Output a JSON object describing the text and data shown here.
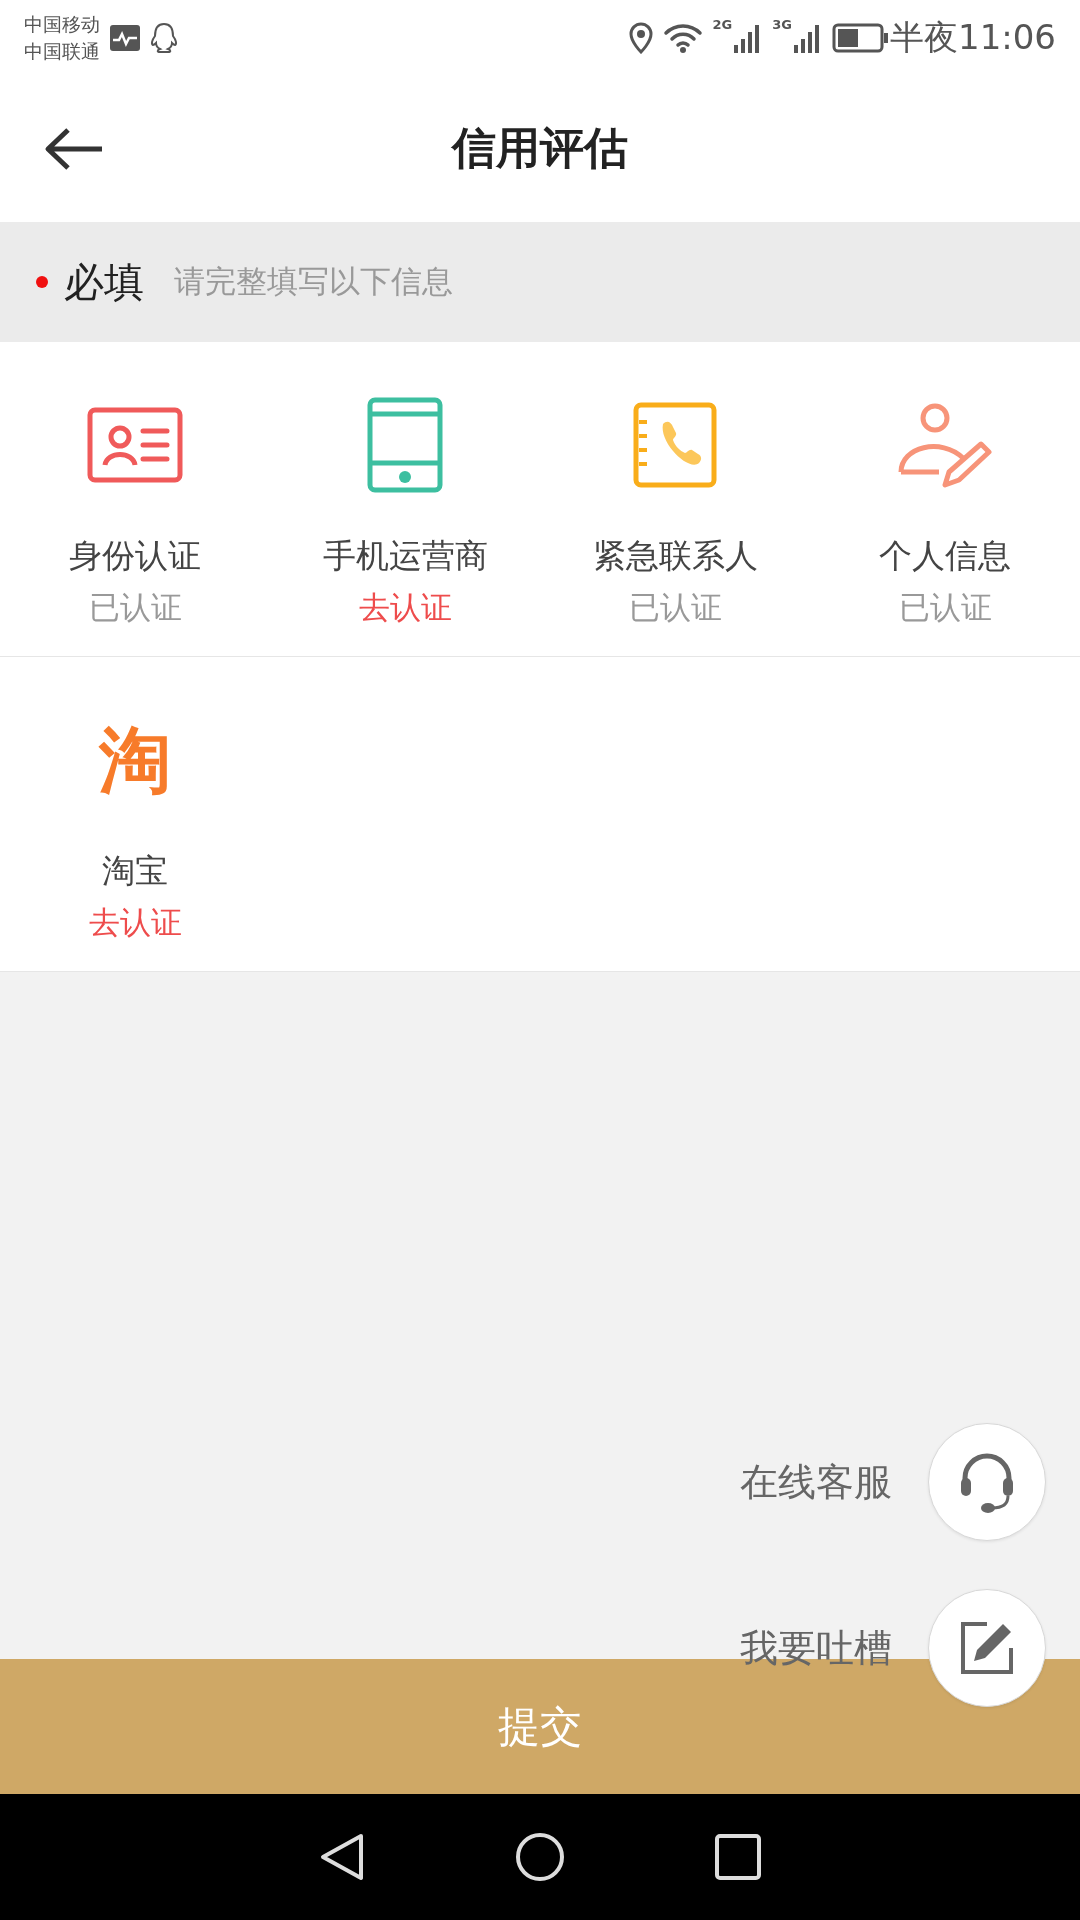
{
  "status_bar": {
    "carriers": [
      "中国移动",
      "中国联通"
    ],
    "networks": [
      "2G",
      "3G"
    ],
    "time": "半夜11:06"
  },
  "header": {
    "title": "信用评估"
  },
  "notice": {
    "label": "必填",
    "hint": "请完整填写以下信息"
  },
  "auth_items": [
    {
      "kind": "id-card",
      "name": "身份认证",
      "status": "已认证",
      "verified": true
    },
    {
      "kind": "phone",
      "name": "手机运营商",
      "status": "去认证",
      "verified": false
    },
    {
      "kind": "contacts",
      "name": "紧急联系人",
      "status": "已认证",
      "verified": true
    },
    {
      "kind": "profile",
      "name": "个人信息",
      "status": "已认证",
      "verified": true
    },
    {
      "kind": "logo",
      "logo_text": "淘",
      "name": "淘宝",
      "status": "去认证",
      "verified": false
    }
  ],
  "float_actions": [
    {
      "kind": "support",
      "label": "在线客服"
    },
    {
      "kind": "feedback",
      "label": "我要吐槽"
    }
  ],
  "submit": {
    "label": "提交"
  }
}
